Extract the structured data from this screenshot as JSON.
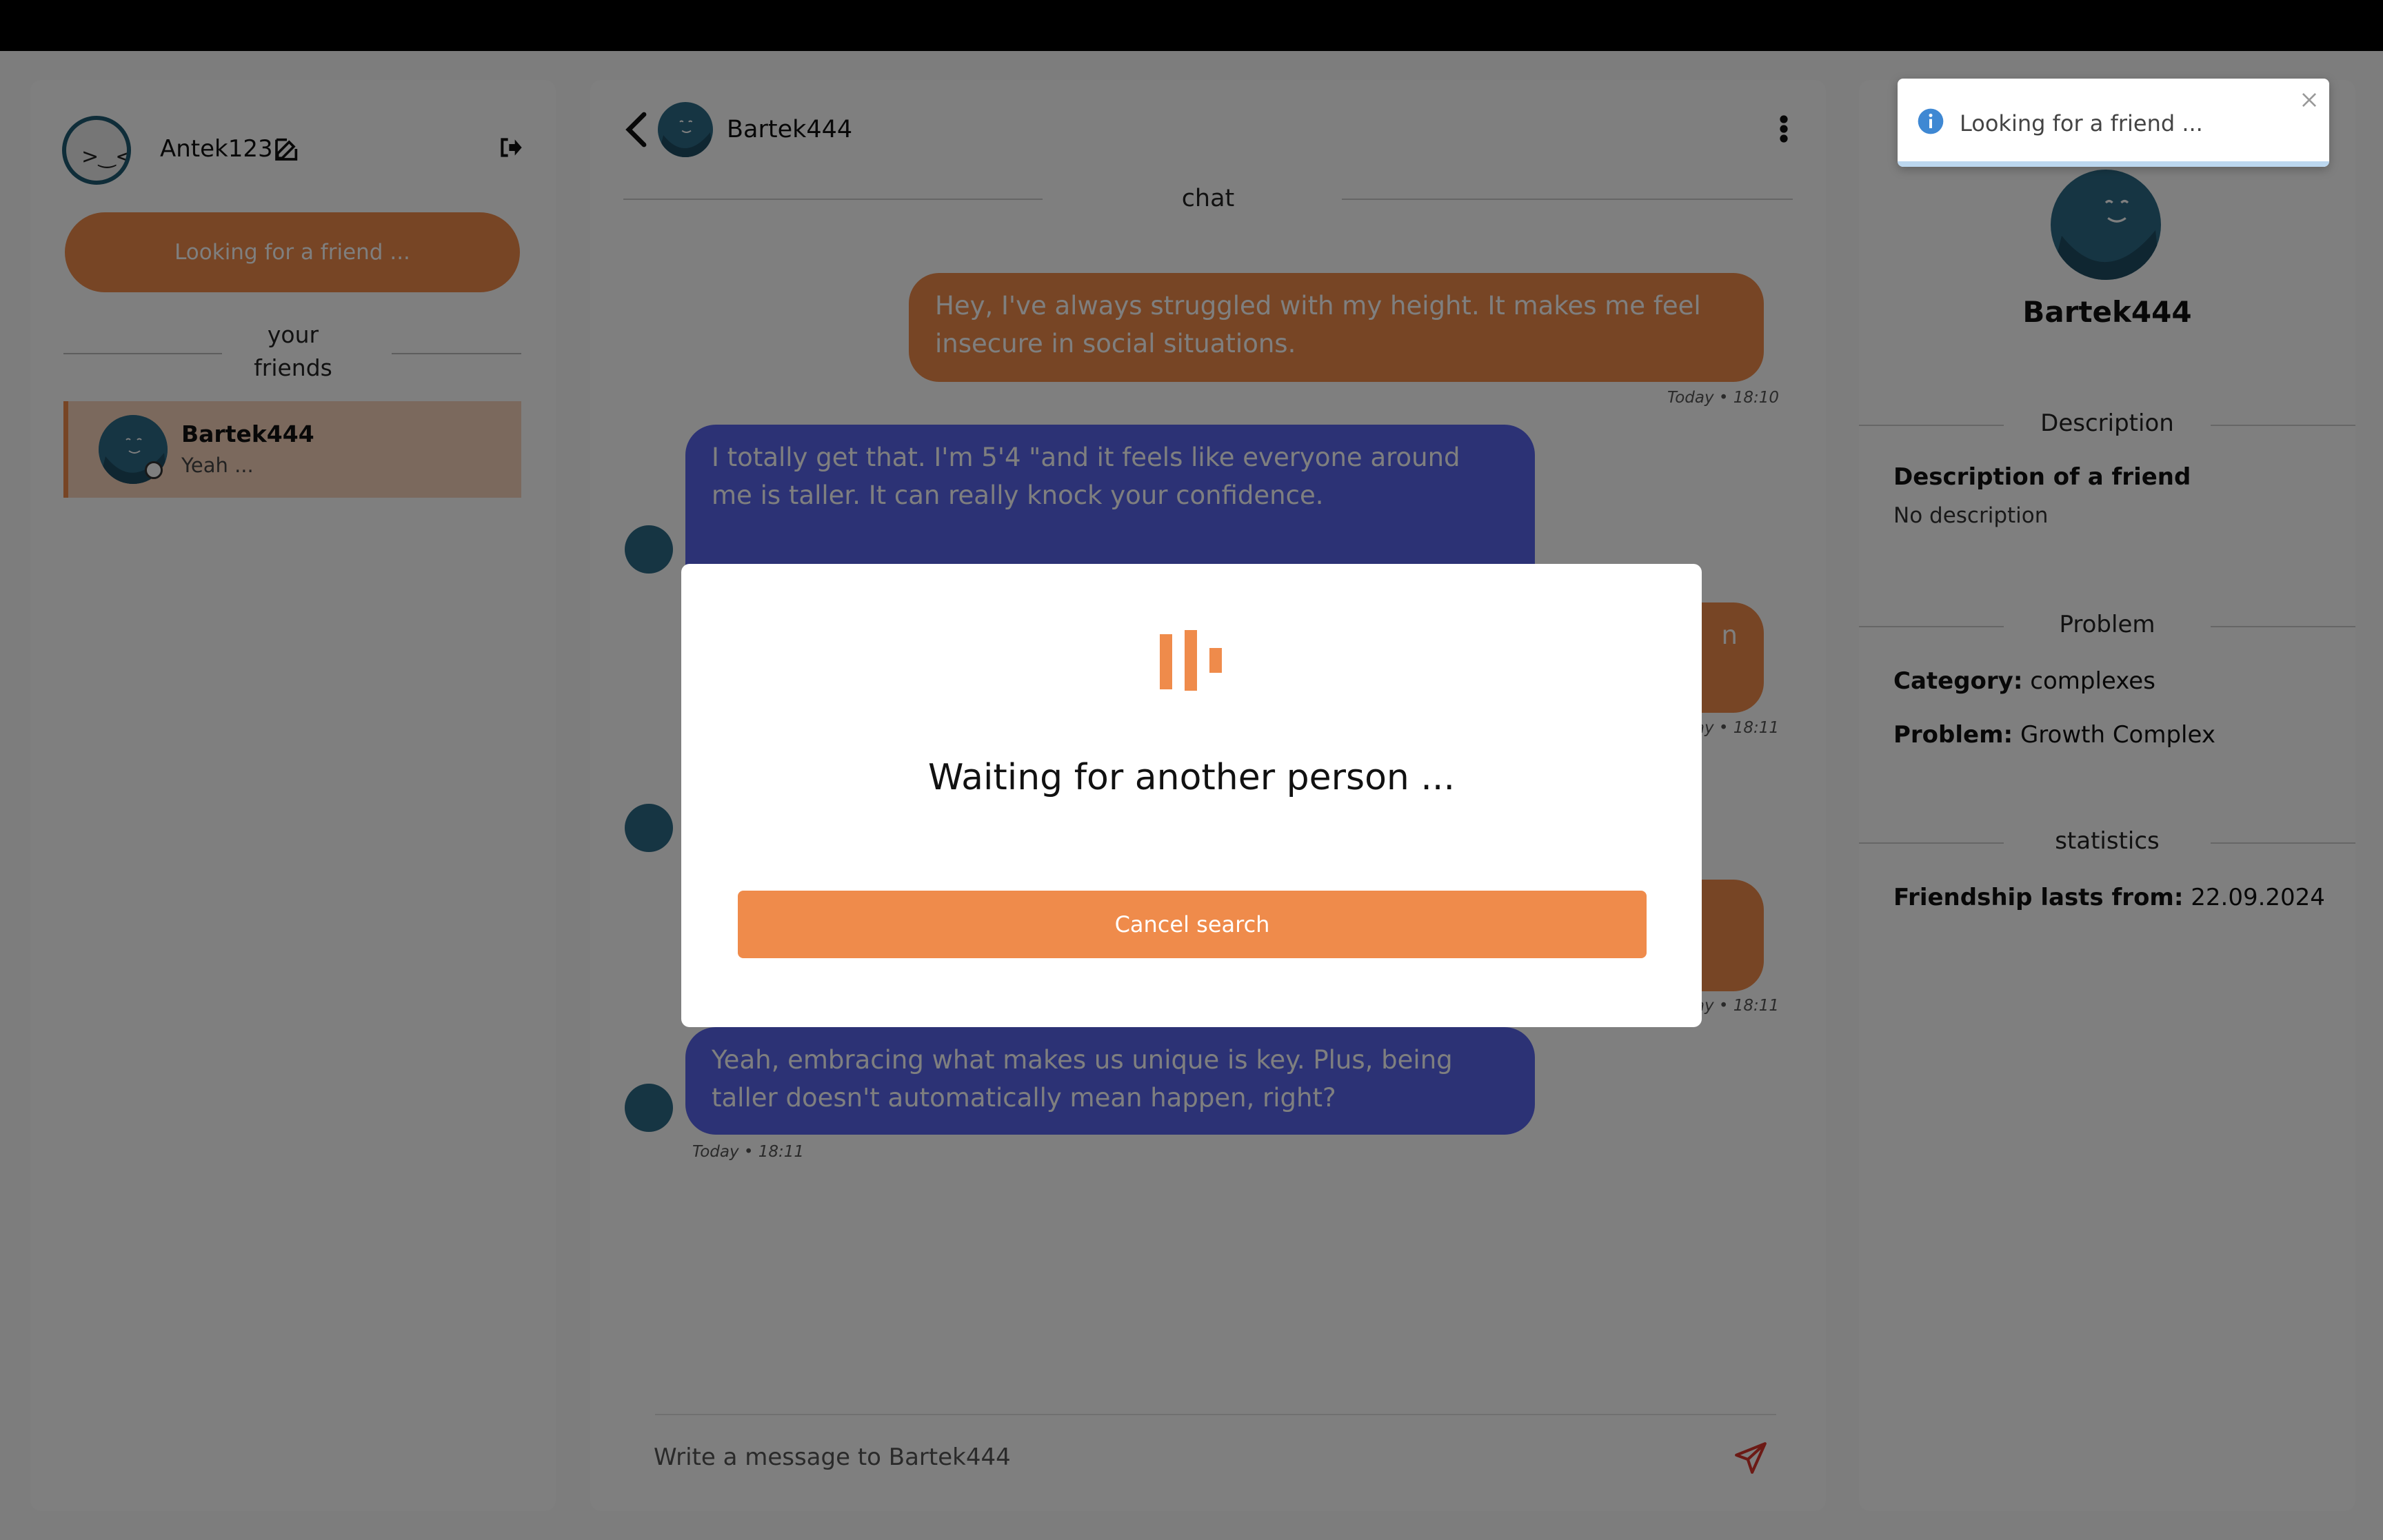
{
  "user": {
    "name": "Antek123"
  },
  "sidebar": {
    "look_button": "Looking for a friend ...",
    "friends_title_1": "your",
    "friends_title_2": "friends",
    "friends": [
      {
        "name": "Bartek444",
        "last_message": "Yeah ..."
      }
    ]
  },
  "chat": {
    "partner": "Bartek444",
    "label": "chat",
    "messages": [
      {
        "dir": "out",
        "text": "Hey, I've always struggled with my height. It makes me feel insecure in social situations.",
        "time": "Today • 18:10"
      },
      {
        "dir": "in",
        "text": "I totally get that. I'm 5'4 \"and it feels like everyone around me is taller. It can really knock your confidence."
      },
      {
        "dir": "out",
        "text": "n",
        "time": "Today • 18:11"
      },
      {
        "dir": "out",
        "text": "",
        "time": "Today • 18:11"
      },
      {
        "dir": "in",
        "text": "Yeah, embracing what makes us unique is key. Plus, being taller doesn't automatically mean happen, right?",
        "time": "Today • 18:11"
      }
    ],
    "input_placeholder": "Write a message to Bartek444"
  },
  "profile": {
    "name": "Bartek444",
    "description_title": "Description",
    "description_label": "Description of a friend",
    "description_value": "No description",
    "problem_title": "Problem",
    "category_label": "Category:",
    "category_value": "complexes",
    "problem_label": "Problem:",
    "problem_value": "Growth Complex",
    "statistics_title": "statistics",
    "friendship_label": "Friendship lasts from:",
    "friendship_value": "22.09.2024"
  },
  "modal": {
    "title": "Waiting for another person ...",
    "cancel_button": "Cancel search"
  },
  "toast": {
    "text": "Looking for a friend ..."
  },
  "colors": {
    "accent": "#ef8b4b",
    "incoming": "#5865ea",
    "avatar": "#2c6a87"
  }
}
